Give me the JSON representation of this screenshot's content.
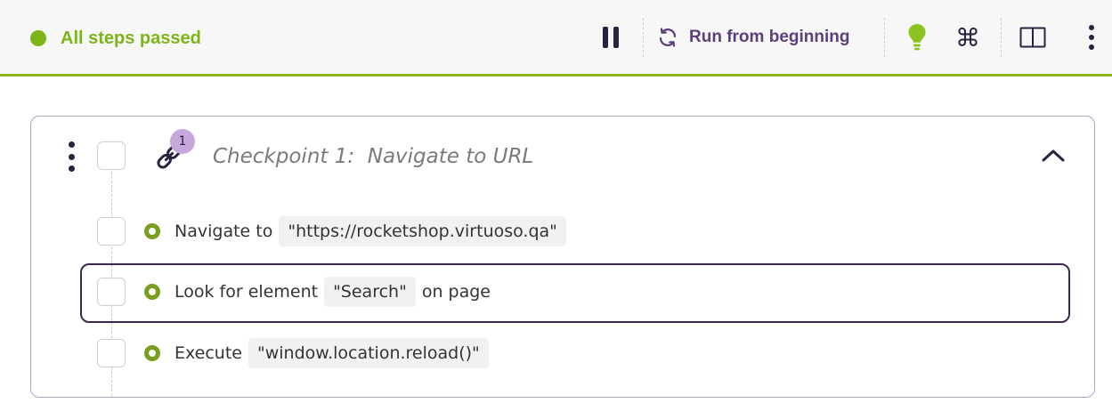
{
  "header": {
    "status_text": "All steps passed",
    "status_color": "#7cb518",
    "run_label": "Run from beginning",
    "icons": [
      "pause-icon",
      "refresh-icon",
      "lightbulb-icon",
      "command-icon",
      "split-view-icon",
      "more-vertical-icon"
    ]
  },
  "checkpoint": {
    "badge": "1",
    "title_prefix": "Checkpoint 1:",
    "title_name": "Navigate to URL",
    "icon": "link-icon",
    "expanded": true
  },
  "steps": [
    {
      "prefix": "Navigate to",
      "value": "\"https://rocketshop.virtuoso.qa\"",
      "suffix": "",
      "status": "passed",
      "selected": false
    },
    {
      "prefix": "Look for element",
      "value": "\"Search\"",
      "suffix": "on page",
      "status": "passed",
      "selected": true
    },
    {
      "prefix": "Execute",
      "value": "\"window.location.reload()\"",
      "suffix": "",
      "status": "passed",
      "selected": false
    }
  ],
  "colors": {
    "accent_green": "#8cb61c",
    "brand_purple": "#5b3f7a",
    "dark_navy": "#2b2140",
    "badge_lilac": "#c7a8dc"
  }
}
